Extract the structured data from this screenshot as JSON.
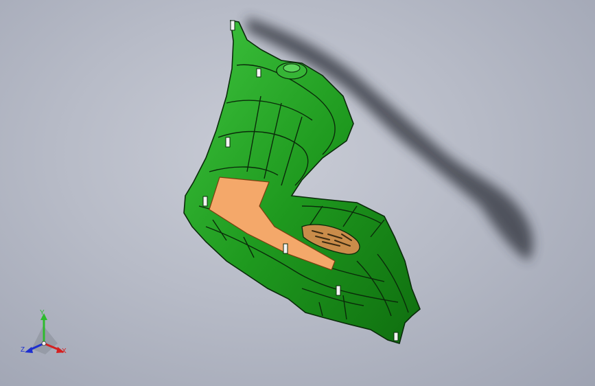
{
  "viewport": {
    "background": "#b7bbc7",
    "part_color": "#1e9e1e",
    "highlight_face_color": "#f4a86a",
    "edge_color": "#0a2a0a"
  },
  "triad": {
    "x_label": "X",
    "y_label": "Y",
    "z_label": "Z",
    "x_color": "#d42020",
    "y_color": "#2dbb2d",
    "z_color": "#1c2ed0"
  }
}
